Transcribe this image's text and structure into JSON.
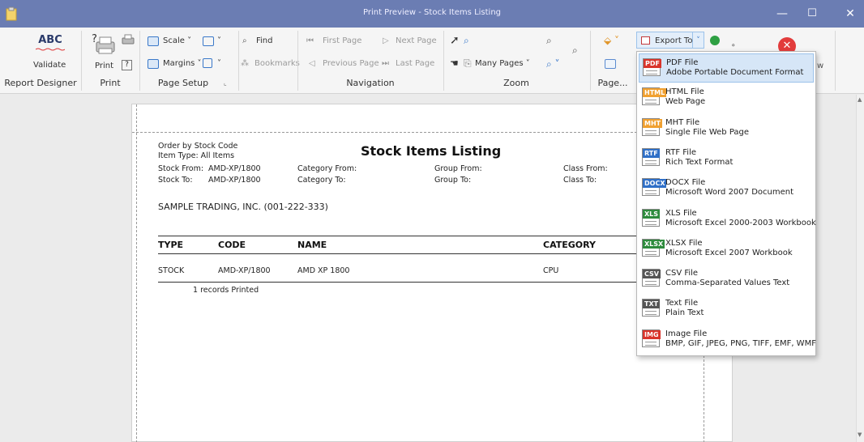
{
  "window": {
    "title": "Print Preview - Stock Items Listing",
    "minimize": "—",
    "maximize": "☐",
    "close": "✕"
  },
  "ribbon": {
    "report_designer": {
      "validate_label": "Validate",
      "abc": "ABC",
      "group": "Report Designer"
    },
    "print": {
      "print_label": "Print",
      "group": "Print"
    },
    "page_setup": {
      "scale_label": "Scale",
      "margins_label": "Margins",
      "group": "Page Setup"
    },
    "find": {
      "find_label": "Find",
      "bookmarks_label": "Bookmarks"
    },
    "navigation": {
      "first_page": "First Page",
      "previous_page": "Previous Page",
      "next_page": "Next Page",
      "last_page": "Last Page",
      "group": "Navigation"
    },
    "zoom": {
      "many_pages_label": "Many Pages",
      "group": "Zoom"
    },
    "page": {
      "group": "Page..."
    },
    "export": {
      "export_label": "Export To",
      "partial_w": "w"
    }
  },
  "report": {
    "order_by": "Order by Stock Code",
    "item_type": "Item Type: All Items",
    "title": "Stock Items Listing",
    "stock_from_label": "Stock From:",
    "stock_from_value": "AMD-XP/1800",
    "stock_to_label": "Stock To:",
    "stock_to_value": "AMD-XP/1800",
    "category_from": "Category From:",
    "category_to": "Category To:",
    "group_from": "Group From:",
    "group_to": "Group To:",
    "class_from": "Class From:",
    "class_to": "Class To:",
    "company": "SAMPLE TRADING, INC. (001-222-333)",
    "columns": [
      "TYPE",
      "CODE",
      "NAME",
      "CATEGORY"
    ],
    "rows": [
      {
        "type": "STOCK",
        "code": "AMD-XP/1800",
        "name": "AMD XP 1800",
        "category": "CPU"
      }
    ],
    "footer": "1 records Printed"
  },
  "export_menu": {
    "items": [
      {
        "tag": "PDF",
        "color": "#d9342b",
        "title": "PDF File",
        "desc": "Adobe Portable Document Format",
        "selected": true
      },
      {
        "tag": "HTML",
        "color": "#f0a030",
        "title": "HTML File",
        "desc": "Web Page"
      },
      {
        "tag": "MHT",
        "color": "#f0a030",
        "title": "MHT File",
        "desc": "Single File Web Page"
      },
      {
        "tag": "RTF",
        "color": "#2f6fc7",
        "title": "RTF File",
        "desc": "Rich Text Format"
      },
      {
        "tag": "DOCX",
        "color": "#2f6fc7",
        "title": "DOCX File",
        "desc": "Microsoft Word 2007 Document"
      },
      {
        "tag": "XLS",
        "color": "#2e8b3d",
        "title": "XLS File",
        "desc": "Microsoft Excel 2000-2003 Workbook"
      },
      {
        "tag": "XLSX",
        "color": "#2e8b3d",
        "title": "XLSX File",
        "desc": "Microsoft Excel 2007 Workbook"
      },
      {
        "tag": "CSV",
        "color": "#555555",
        "title": "CSV File",
        "desc": "Comma-Separated Values Text"
      },
      {
        "tag": "TXT",
        "color": "#555555",
        "title": "Text File",
        "desc": "Plain Text"
      },
      {
        "tag": "IMG",
        "color": "#d9342b",
        "title": "Image File",
        "desc": "BMP, GIF, JPEG, PNG, TIFF, EMF, WMF"
      }
    ]
  },
  "colors": {
    "titlebar": "#6b7db3",
    "menu_selected": "#d6e6f7"
  }
}
